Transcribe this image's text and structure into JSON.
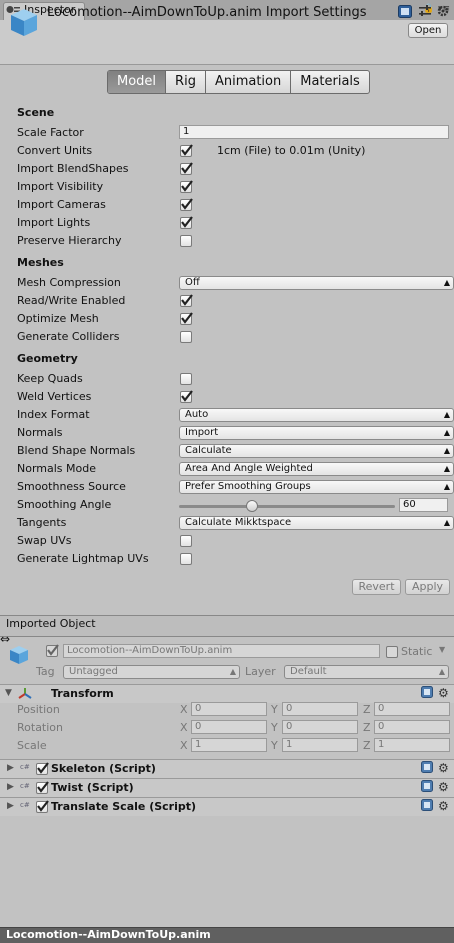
{
  "tab": {
    "label": "Inspector"
  },
  "header": {
    "title": "Locomotion--AimDownToUp.anim Import Settings",
    "open_label": "Open"
  },
  "tabs": [
    "Model",
    "Rig",
    "Animation",
    "Materials"
  ],
  "active_tab": "Model",
  "scene": {
    "title": "Scene",
    "scale_factor_label": "Scale Factor",
    "scale_factor_value": "1",
    "convert_units_label": "Convert Units",
    "convert_units_note": "1cm (File) to 0.01m (Unity)",
    "import_blendshapes_label": "Import BlendShapes",
    "import_visibility_label": "Import Visibility",
    "import_cameras_label": "Import Cameras",
    "import_lights_label": "Import Lights",
    "preserve_hierarchy_label": "Preserve Hierarchy"
  },
  "meshes": {
    "title": "Meshes",
    "mesh_compression_label": "Mesh Compression",
    "mesh_compression_value": "Off",
    "read_write_label": "Read/Write Enabled",
    "optimize_mesh_label": "Optimize Mesh",
    "generate_colliders_label": "Generate Colliders"
  },
  "geometry": {
    "title": "Geometry",
    "keep_quads_label": "Keep Quads",
    "weld_vertices_label": "Weld Vertices",
    "index_format_label": "Index Format",
    "index_format_value": "Auto",
    "normals_label": "Normals",
    "normals_value": "Import",
    "blend_shape_normals_label": "Blend Shape Normals",
    "blend_shape_normals_value": "Calculate",
    "normals_mode_label": "Normals Mode",
    "normals_mode_value": "Area And Angle Weighted",
    "smoothness_source_label": "Smoothness Source",
    "smoothness_source_value": "Prefer Smoothing Groups",
    "smoothing_angle_label": "Smoothing Angle",
    "smoothing_angle_value": "60",
    "smoothing_angle_fraction": 0.333,
    "tangents_label": "Tangents",
    "tangents_value": "Calculate Mikktspace",
    "swap_uvs_label": "Swap UVs",
    "generate_lightmap_uvs_label": "Generate Lightmap UVs"
  },
  "buttons": {
    "revert": "Revert",
    "apply": "Apply"
  },
  "imported_object": {
    "header": "Imported Object",
    "name": "Locomotion--AimDownToUp.anim",
    "static_label": "Static",
    "tag_label": "Tag",
    "tag_value": "Untagged",
    "layer_label": "Layer",
    "layer_value": "Default"
  },
  "transform": {
    "title": "Transform",
    "position_label": "Position",
    "rotation_label": "Rotation",
    "scale_label": "Scale",
    "axis_x": "X",
    "axis_y": "Y",
    "axis_z": "Z",
    "position": [
      "0",
      "0",
      "0"
    ],
    "rotation": [
      "0",
      "0",
      "0"
    ],
    "scale": [
      "1",
      "1",
      "1"
    ]
  },
  "components": [
    "Skeleton (Script)",
    "Twist (Script)",
    "Translate Scale (Script)"
  ],
  "status": {
    "text": "Locomotion--AimDownToUp.anim"
  },
  "colors": {
    "active_tab": "#8a8a8a",
    "panel": "#c2c2c2",
    "statusbar": "#606060"
  }
}
